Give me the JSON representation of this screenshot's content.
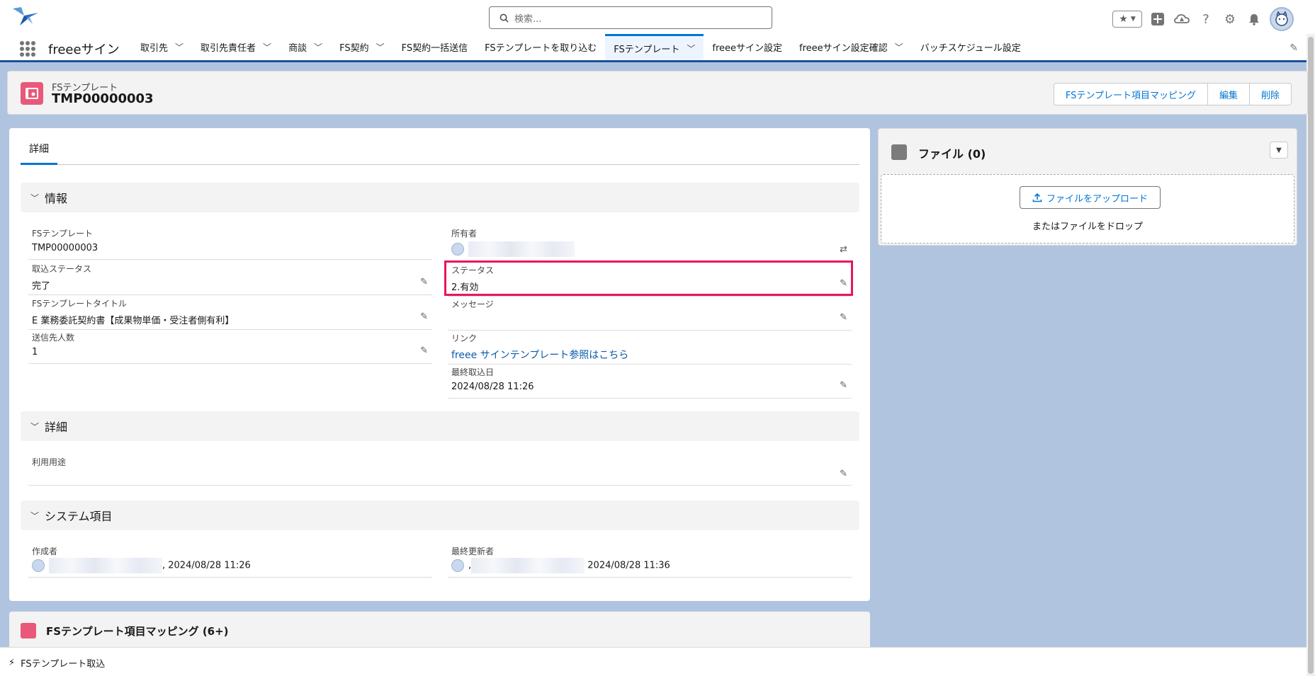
{
  "header": {
    "search_placeholder": "検索...",
    "app_name": "freeeサイン"
  },
  "nav": {
    "items": [
      {
        "label": "取引先",
        "chevron": true
      },
      {
        "label": "取引先責任者",
        "chevron": true
      },
      {
        "label": "商談",
        "chevron": true
      },
      {
        "label": "FS契約",
        "chevron": true
      },
      {
        "label": "FS契約一括送信",
        "chevron": false
      },
      {
        "label": "FSテンプレートを取り込む",
        "chevron": false
      },
      {
        "label": "FSテンプレート",
        "chevron": true,
        "active": true
      },
      {
        "label": "freeeサイン設定",
        "chevron": false
      },
      {
        "label": "freeeサイン設定確認",
        "chevron": true
      },
      {
        "label": "バッチスケジュール設定",
        "chevron": false
      }
    ]
  },
  "record": {
    "object_type": "FSテンプレート",
    "name": "TMP00000003",
    "buttons": {
      "mapping": "FSテンプレート項目マッピング",
      "edit": "編集",
      "delete": "削除"
    }
  },
  "detail": {
    "tab_label": "詳細",
    "section_info": "情報",
    "section_detail": "詳細",
    "section_system": "システム項目",
    "fields": {
      "fs_template_label": "FSテンプレート",
      "fs_template_value": "TMP00000003",
      "owner_label": "所有者",
      "import_status_label": "取込ステータス",
      "import_status_value": "完了",
      "status_label": "ステータス",
      "status_value": "2.有効",
      "title_label": "FSテンプレートタイトル",
      "title_value": "E 業務委託契約書【成果物単価・受注者側有利】",
      "message_label": "メッセージ",
      "message_value": "",
      "recipients_label": "送信先人数",
      "recipients_value": "1",
      "link_label": "リンク",
      "link_value": "freee サインテンプレート参照はこちら",
      "last_import_label": "最終取込日",
      "last_import_value": "2024/08/28 11:26",
      "usage_label": "利用用途",
      "usage_value": "",
      "created_by_label": "作成者",
      "created_by_date": ", 2024/08/28 11:26",
      "modified_by_label": "最終更新者",
      "modified_by_prefix": ",",
      "modified_by_date": "2024/08/28 11:36"
    }
  },
  "files": {
    "title": "ファイル (0)",
    "upload_label": "ファイルをアップロード",
    "drop_text": "またはファイルをドロップ"
  },
  "related": {
    "title": "FSテンプレート項目マッピング (6+)"
  },
  "utility": {
    "item_label": "FSテンプレート取込"
  },
  "colors": {
    "accent": "#0176d3",
    "highlight": "#e8175d",
    "brand_bar": "#1b5297",
    "object_icon": "#e9587a"
  }
}
